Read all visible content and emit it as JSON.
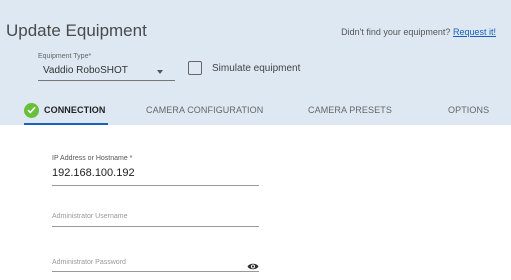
{
  "header": {
    "title": "Update Equipment",
    "request_prefix": "Didn't find your equipment?",
    "request_link": "Request it!"
  },
  "equipment": {
    "type_label": "Equipment Type*",
    "type_value": "Vaddio RoboSHOT",
    "simulate_label": "Simulate equipment",
    "simulate_checked": false
  },
  "tabs": [
    {
      "label": "CONNECTION",
      "active": true,
      "icon": "check-circle-icon"
    },
    {
      "label": "CAMERA CONFIGURATION",
      "active": false
    },
    {
      "label": "CAMERA PRESETS",
      "active": false
    },
    {
      "label": "OPTIONS",
      "active": false
    }
  ],
  "form": {
    "ip_label": "IP Address or Hostname *",
    "ip_value": "192.168.100.192",
    "username_placeholder": "Administrator Username",
    "password_placeholder": "Administrator Password",
    "password_icon": "eye-icon"
  },
  "colors": {
    "header_bg": "#dde8f3",
    "accent": "#1565c0",
    "success": "#6abf3a",
    "link": "#1a5fb4"
  }
}
